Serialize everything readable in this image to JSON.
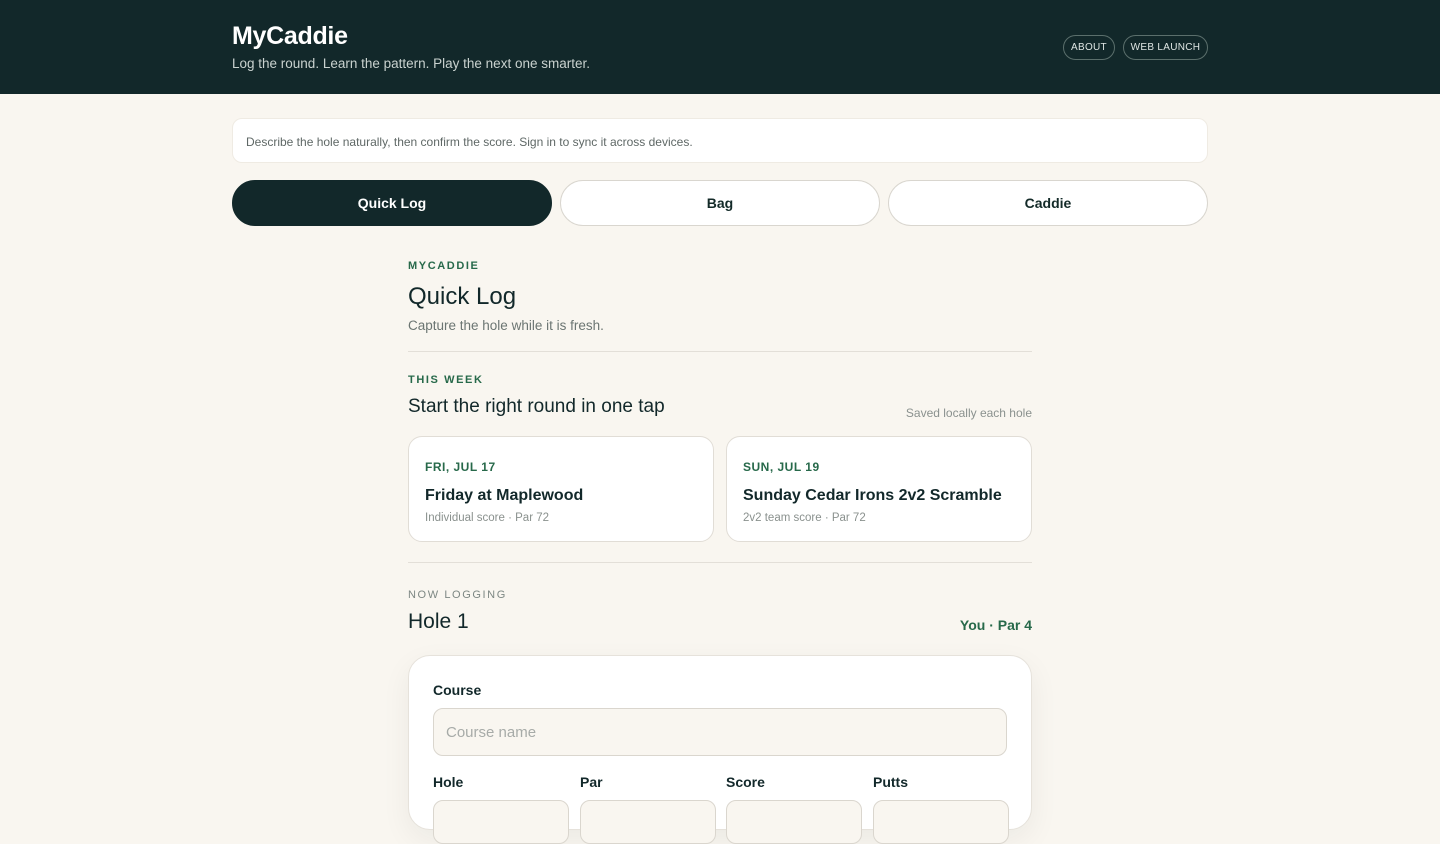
{
  "header": {
    "title": "MyCaddie",
    "tagline": "Log the round. Learn the pattern. Play the next one smarter.",
    "links": [
      "ABOUT",
      "WEB LAUNCH"
    ]
  },
  "notice": "Describe the hole naturally, then confirm the score. Sign in to sync it across devices.",
  "tabs": [
    {
      "label": "Quick Log",
      "active": true
    },
    {
      "label": "Bag",
      "active": false
    },
    {
      "label": "Caddie",
      "active": false
    }
  ],
  "page": {
    "eyebrow": "MYCADDIE",
    "title": "Quick Log",
    "subtitle": "Capture the hole while it is fresh."
  },
  "this_week": {
    "eyebrow": "THIS WEEK",
    "title": "Start the right round in one tap",
    "note": "Saved locally each hole",
    "rounds": [
      {
        "date": "FRI, JUL 17",
        "name": "Friday at Maplewood",
        "meta": "Individual score · Par 72"
      },
      {
        "date": "SUN, JUL 19",
        "name": "Sunday Cedar Irons 2v2 Scramble",
        "meta": "2v2 team score · Par 72"
      }
    ]
  },
  "logging": {
    "eyebrow": "NOW LOGGING",
    "hole_title": "Hole 1",
    "hole_meta": "You · Par 4",
    "form": {
      "course_label": "Course",
      "course_placeholder": "Course name",
      "fields": [
        "Hole",
        "Par",
        "Score",
        "Putts"
      ]
    }
  },
  "colors": {
    "header_bg": "#12282a",
    "accent_green": "#27694a",
    "page_bg": "#f9f6f0"
  }
}
